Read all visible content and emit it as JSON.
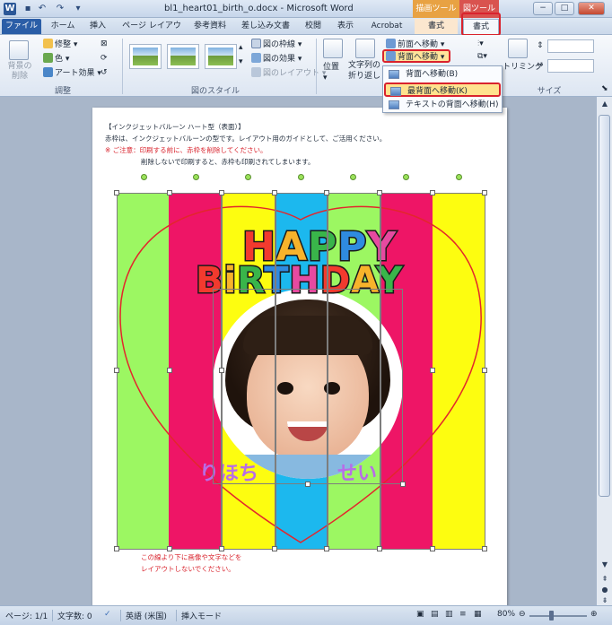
{
  "window": {
    "title": "bl1_heart01_birth_o.docx - Microsoft Word",
    "app_icon": "W",
    "quick_access": [
      "save-icon",
      "undo-icon",
      "redo-icon",
      "customize-icon"
    ],
    "contextual_headers": [
      "描画ツール",
      "図ツール"
    ],
    "controls": [
      "−",
      "□",
      "✕"
    ]
  },
  "tabs": [
    "ファイル",
    "ホーム",
    "挿入",
    "ページ レイアウト",
    "参考資料",
    "差し込み文書",
    "校閲",
    "表示",
    "Acrobat",
    "書式",
    "書式"
  ],
  "ribbon": {
    "adjust": {
      "remove_bg": "背景の削除",
      "items": [
        "修整",
        "色",
        "アート効果"
      ],
      "label": "調整"
    },
    "picture_styles": {
      "items": [
        "図の枠線",
        "図の効果",
        "図のレイアウト"
      ],
      "label": "図のスタイル"
    },
    "arrange": {
      "position": "位置",
      "wrap_line1": "文字列の",
      "wrap_line2": "折り返し",
      "bring_forward": "前面へ移動",
      "send_backward": "背面へ移動"
    },
    "size": {
      "crop": "トリミング",
      "label": "サイズ"
    }
  },
  "dropdown_menu": {
    "items": [
      "背面へ移動(B)",
      "最背面へ移動(K)",
      "テキストの背面へ移動(H)"
    ],
    "highlighted_index": 1
  },
  "document": {
    "header_lines": [
      "【インクジェットバルーン ハート型（表面）】",
      "赤枠は、インクジェットバルーンの型です。レイアウト用のガイドとして、ご活用ください。",
      "※ ご注意：印刷する前に、赤枠を削除してください。",
      "削除しないで印刷すると、赤枠も印刷されてしまいます。"
    ],
    "footer_lines": [
      "この線より下に画像や文字などを",
      "レイアウトしないでください。"
    ],
    "art_title_1": "HAPPY",
    "art_title_2": "BiRTHDAY",
    "name_text": "りほち　　　　せい",
    "stripe_colors": [
      "#9cf762",
      "#ee1566",
      "#fdfd10",
      "#1cb8ee",
      "#9cf762",
      "#ee1566",
      "#fdfd10"
    ]
  },
  "status": {
    "page": "ページ: 1/1",
    "words": "文字数: 0",
    "language": "英語 (米国)",
    "mode": "挿入モード",
    "zoom": "80%"
  },
  "colors": {
    "highlight_border": "#d9232d",
    "highlight_fill": "#ffe28e",
    "heart_outline": "#e3262c"
  }
}
